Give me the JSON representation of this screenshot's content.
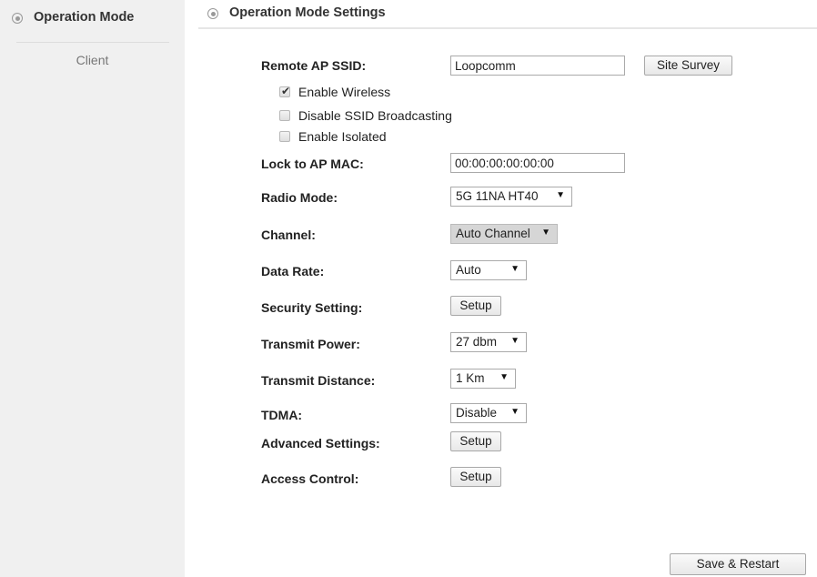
{
  "sidebar": {
    "title": "Operation Mode",
    "items": [
      {
        "label": "Client"
      }
    ]
  },
  "main": {
    "title": "Operation Mode Settings"
  },
  "form": {
    "remote_ssid": {
      "label": "Remote AP SSID:",
      "value": "Loopcomm",
      "button": "Site Survey"
    },
    "checkboxes": [
      {
        "label": "Enable Wireless",
        "checked": true
      },
      {
        "label": "Disable SSID Broadcasting",
        "checked": false
      },
      {
        "label": "Enable Isolated",
        "checked": false
      }
    ],
    "lock_mac": {
      "label": "Lock to AP MAC:",
      "value": "00:00:00:00:00:00"
    },
    "radio_mode": {
      "label": "Radio Mode:",
      "value": "5G 11NA HT40"
    },
    "channel": {
      "label": "Channel:",
      "value": "Auto Channel",
      "disabled": true
    },
    "data_rate": {
      "label": "Data Rate:",
      "value": "Auto"
    },
    "security": {
      "label": "Security Setting:",
      "button": "Setup"
    },
    "transmit_power": {
      "label": "Transmit Power:",
      "value": "27 dbm"
    },
    "transmit_distance": {
      "label": "Transmit Distance:",
      "value": "1 Km"
    },
    "tdma": {
      "label": "TDMA:",
      "value": "Disable"
    },
    "advanced": {
      "label": "Advanced Settings:",
      "button": "Setup"
    },
    "access_control": {
      "label": "Access Control:",
      "button": "Setup"
    }
  },
  "footer": {
    "save_button": "Save & Restart"
  },
  "icons": {
    "section": "radio-ring-icon",
    "dropdown": "triangle-down-icon",
    "check": "checkmark-icon"
  }
}
